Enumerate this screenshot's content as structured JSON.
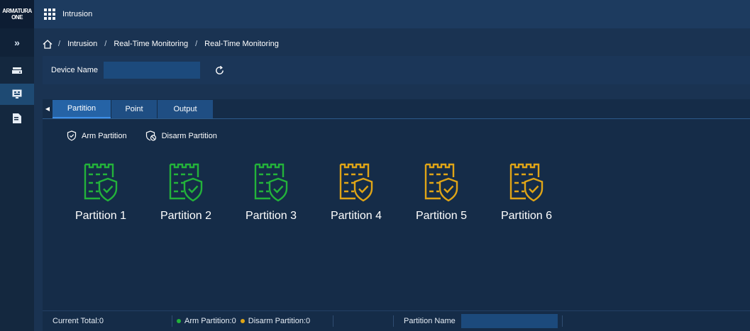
{
  "app": {
    "logo_line1": "ARMATURA",
    "logo_line2": "ONE",
    "title": "Intrusion"
  },
  "sidebar": {
    "expand_label": "»",
    "items": [
      {
        "icon": "drive-icon",
        "active": false
      },
      {
        "icon": "monitor-icon",
        "active": true
      },
      {
        "icon": "report-icon",
        "active": false
      }
    ]
  },
  "breadcrumb": {
    "sep": "/",
    "items": [
      "Intrusion",
      "Real-Time Monitoring",
      "Real-Time Monitoring"
    ]
  },
  "filter": {
    "device_name_label": "Device Name",
    "device_name_value": ""
  },
  "tabs": {
    "partition": "Partition",
    "point": "Point",
    "output": "Output",
    "active": "Partition"
  },
  "actions": {
    "arm": "Arm Partition",
    "disarm": "Disarm Partition"
  },
  "partitions": [
    {
      "name": "Partition 1",
      "status": "armed"
    },
    {
      "name": "Partition 2",
      "status": "armed"
    },
    {
      "name": "Partition 3",
      "status": "armed"
    },
    {
      "name": "Partition 4",
      "status": "disarmed"
    },
    {
      "name": "Partition 5",
      "status": "disarmed"
    },
    {
      "name": "Partition 6",
      "status": "disarmed"
    }
  ],
  "status_bar": {
    "current_total": "Current Total:0",
    "arm_count": "Arm Partition:0",
    "disarm_count": "Disarm Partition:0",
    "partition_name_label": "Partition Name",
    "partition_name_value": ""
  },
  "colors": {
    "armed": "#23b33a",
    "disarmed": "#e0a516",
    "accent": "#2563a6"
  }
}
